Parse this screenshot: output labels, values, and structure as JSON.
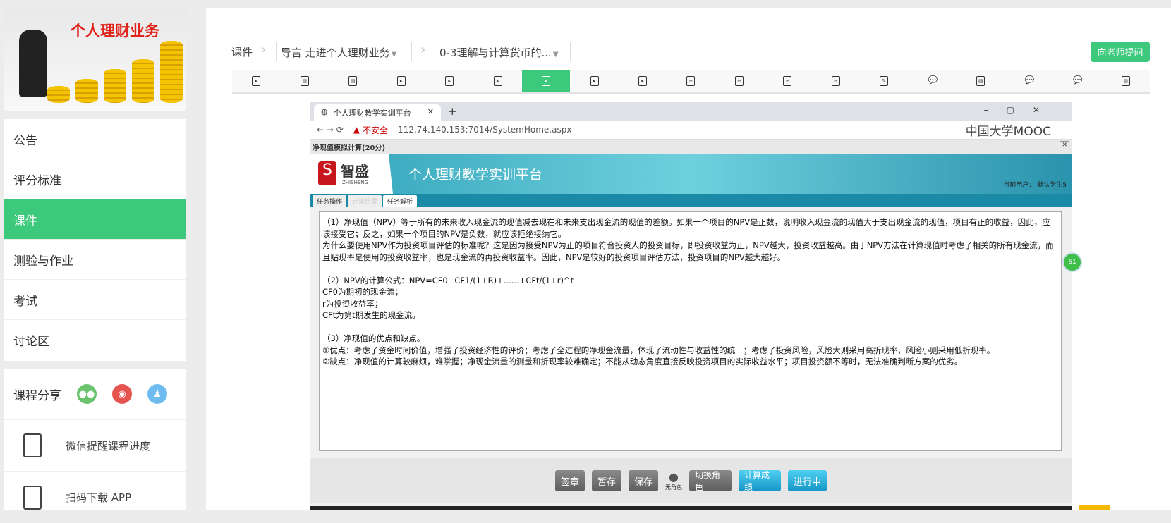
{
  "banner": {
    "title": "个人理财业务"
  },
  "sidebar": {
    "items": [
      {
        "label": "公告"
      },
      {
        "label": "评分标准"
      },
      {
        "label": "课件"
      },
      {
        "label": "测验与作业"
      },
      {
        "label": "考试"
      },
      {
        "label": "讨论区"
      }
    ],
    "active": 2
  },
  "share": {
    "label": "课程分享",
    "wechat_reminder": "微信提醒课程进度",
    "download_app": "扫码下载 APP"
  },
  "breadcrumb": {
    "root": "课件",
    "chapter": "导言 走进个人理财业务",
    "lesson": "0-3理解与计算货币的..."
  },
  "ask_button": "向老师提问",
  "unit_icons": [
    "play",
    "doc",
    "doc",
    "play",
    "play",
    "play",
    "play",
    "play",
    "play",
    "list",
    "list",
    "list",
    "list",
    "edit",
    "chat",
    "doc",
    "chat",
    "chat",
    "doc"
  ],
  "active_unit": 6,
  "video": {
    "browser_tab": "个人理财教学实训平台",
    "address_warning": "不安全",
    "url": "112.74.140.153:7014/SystemHome.aspx",
    "watermark": "中国大学MOOC",
    "dialog_title": "净现值模拟计算(20分)",
    "logo_text": "智盛",
    "logo_sub": "ZHISHENG",
    "platform_title": "个人理财教学实训平台",
    "current_user": "当前用户：  默认学生5",
    "tabs": [
      "任务操作",
      "计算结果",
      "任务解析"
    ],
    "content": [
      "（1）净现值（NPV）等于所有的未来收入现金流的现值减去现在和未来支出现金流的现值的差额。如果一个项目的NPV是正数，说明收入现金流的现值大于支出现金流的现值，项目有正的收益，因此，应该接受它；反之，如果一个项目的NPV是负数，就应该拒绝接纳它。",
      "为什么要使用NPV作为投资项目评估的标准呢？这是因为接受NPV为正的项目符合投资人的投资目标，即投资收益为正，NPV越大，投资收益越高。由于NPV方法在计算现值时考虑了相关的所有现金流，而且贴现率是使用的投资收益率，也是现金流的再投资收益率。因此，NPV是较好的投资项目评估方法，投资项目的NPV越大越好。",
      "",
      "（2）NPV的计算公式：NPV=CF0+CF1/(1+R)+......+CFt/(1+r)^t",
      "CF0为期初的现金流；",
      "r为投资收益率；",
      "CFt为第t期发生的现金流。",
      "",
      "（3）净现值的优点和缺点。",
      "①优点：考虑了资金时间价值，增强了投资经济性的评价；考虑了全过程的净现金流量，体现了流动性与收益性的统一；考虑了投资风险，风险大则采用高折现率，风险小则采用低折现率。",
      "②缺点：净现值的计算较麻烦，难掌握；净现金流量的测量和折现率较难确定；不能从动态角度直接反映投资项目的实际收益水平；项目投资额不等时，无法准确判断方案的优劣。"
    ],
    "toolbar": {
      "sign": "签章",
      "temp_save": "暂存",
      "save": "保存",
      "no_role": "无角色",
      "switch_role": "切换角色",
      "calc_score": "计算成绩",
      "status": "进行中"
    },
    "bubble": "61"
  }
}
